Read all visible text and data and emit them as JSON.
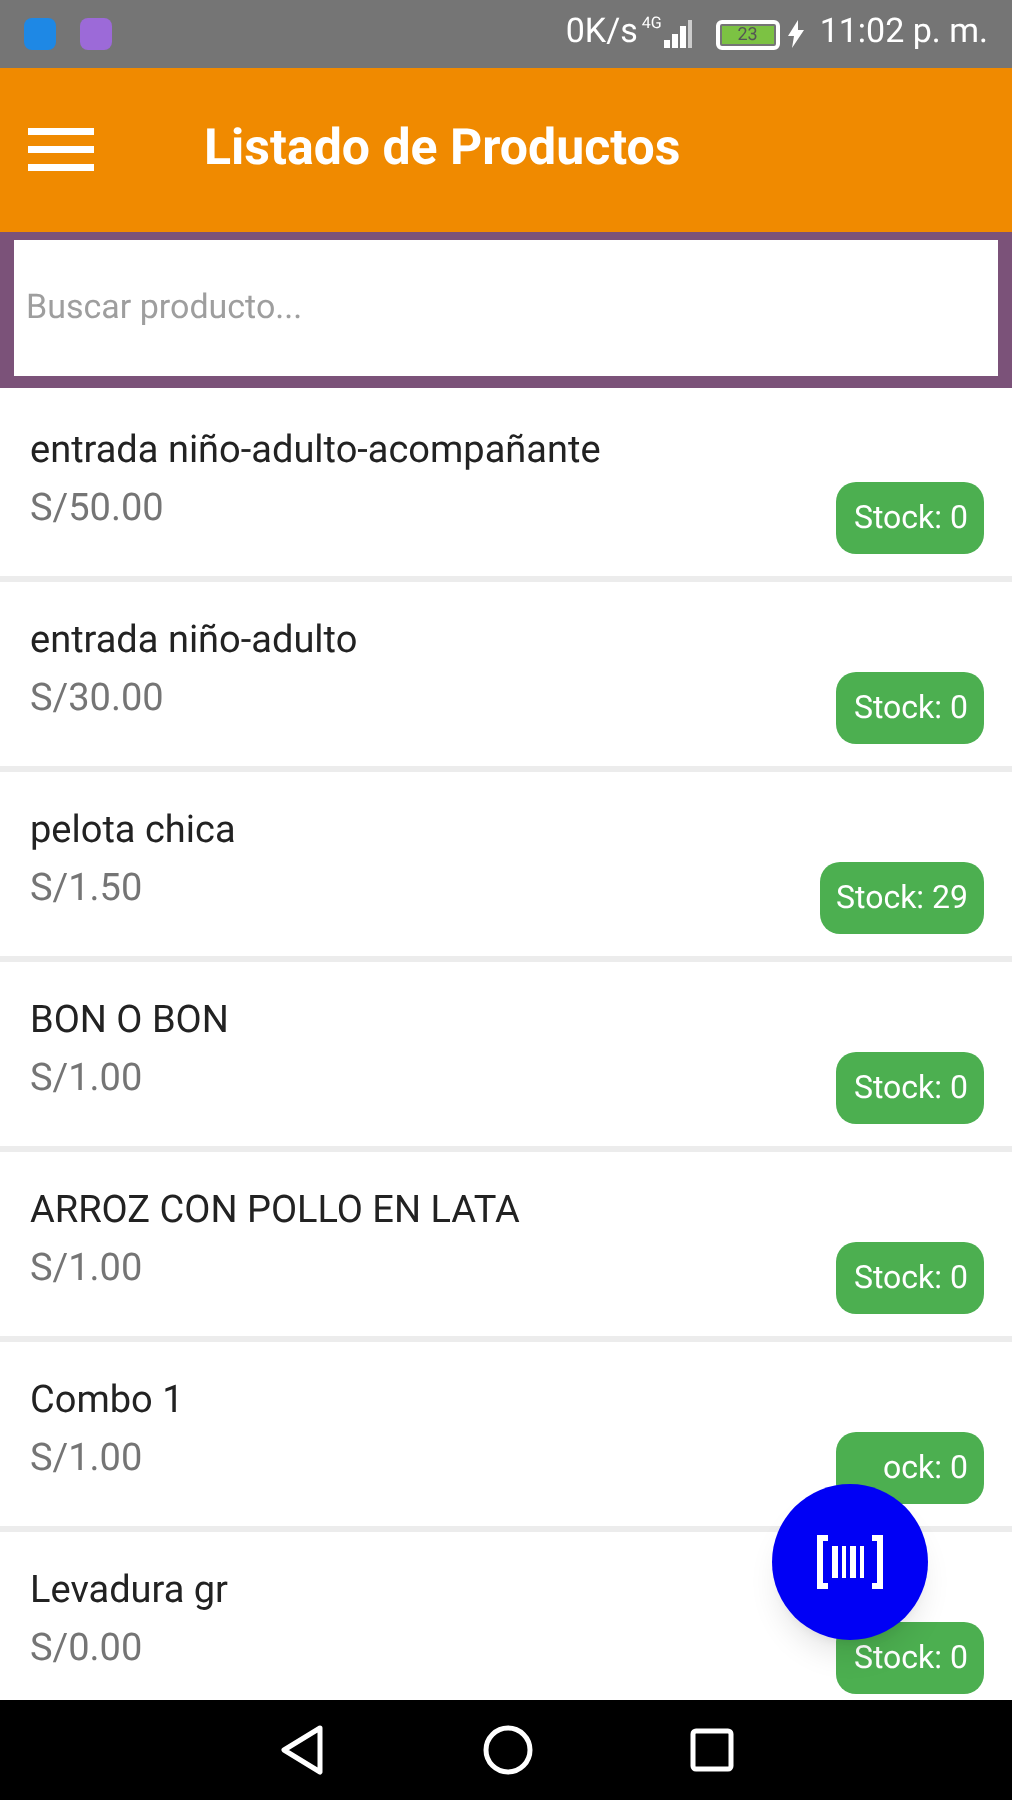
{
  "status_bar": {
    "speed": "0K/s",
    "network": "4G",
    "battery": "23",
    "time": "11:02 p. m."
  },
  "app_bar": {
    "title": "Listado de Productos"
  },
  "search": {
    "placeholder": "Buscar producto..."
  },
  "products": [
    {
      "name": "entrada niño-adulto-acompañante",
      "price": "S/50.00",
      "stock": "Stock: 0"
    },
    {
      "name": "entrada niño-adulto",
      "price": "S/30.00",
      "stock": "Stock: 0"
    },
    {
      "name": "pelota chica",
      "price": "S/1.50",
      "stock": "Stock: 29"
    },
    {
      "name": "BON O BON",
      "price": "S/1.00",
      "stock": "Stock: 0"
    },
    {
      "name": "ARROZ CON POLLO EN LATA",
      "price": "S/1.00",
      "stock": "Stock: 0"
    },
    {
      "name": "Combo 1",
      "price": "S/1.00",
      "stock": "ock: 0"
    },
    {
      "name": "Levadura gr",
      "price": "S/0.00",
      "stock": "Stock: 0"
    }
  ]
}
